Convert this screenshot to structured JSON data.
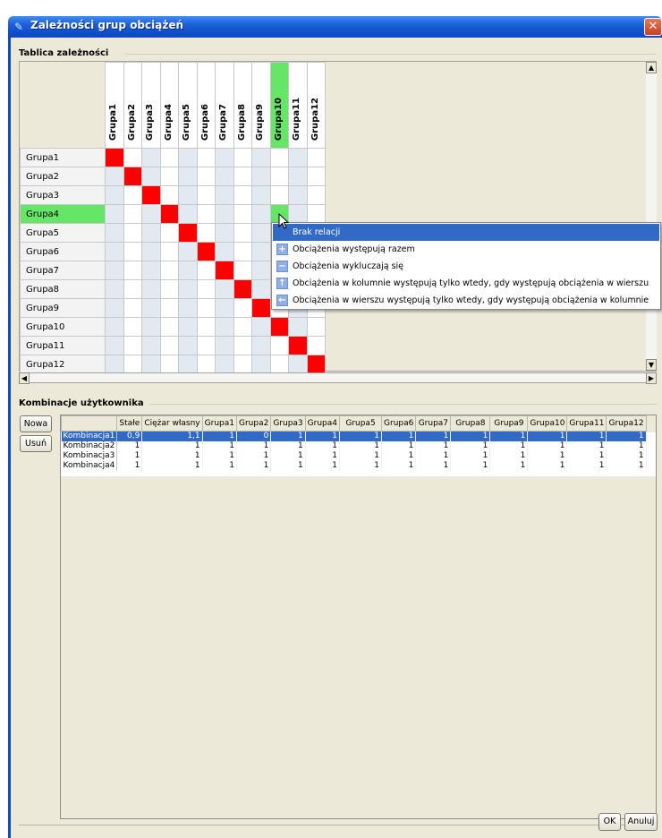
{
  "window": {
    "title": "Zależności grup obciążeń",
    "close_glyph": "✕"
  },
  "matrix_section": {
    "label": "Tablica zależności"
  },
  "matrix": {
    "columns": [
      "Grupa1",
      "Grupa2",
      "Grupa3",
      "Grupa4",
      "Grupa5",
      "Grupa6",
      "Grupa7",
      "Grupa8",
      "Grupa9",
      "Grupa10",
      "Grupa11",
      "Grupa12"
    ],
    "rows": [
      "Grupa1",
      "Grupa2",
      "Grupa3",
      "Grupa4",
      "Grupa5",
      "Grupa6",
      "Grupa7",
      "Grupa8",
      "Grupa9",
      "Grupa10",
      "Grupa11",
      "Grupa12"
    ],
    "highlighted_column": "Grupa10",
    "highlighted_row": "Grupa4",
    "colors": {
      "diagonal": "#ff0000",
      "highlight": "#66e666",
      "stripe": "#e3e9f0"
    }
  },
  "context_menu": {
    "items": [
      {
        "label": "Brak relacji",
        "icon": "none",
        "selected": true
      },
      {
        "label": "Obciążenia występują razem",
        "icon": "plus-icon",
        "selected": false
      },
      {
        "label": "Obciążenia wykluczają się",
        "icon": "minus-icon",
        "selected": false
      },
      {
        "label": "Obciążenia w kolumnie występują tylko wtedy, gdy występują obciążenia w wierszu",
        "icon": "arrow-up-icon",
        "selected": false
      },
      {
        "label": "Obciążenia w wierszu występują tylko wtedy, gdy występują obciążenia w kolumnie",
        "icon": "arrow-left-icon",
        "selected": false
      }
    ]
  },
  "combinations_section": {
    "label": "Kombinacje użytkownika"
  },
  "buttons": {
    "new": "Nowa",
    "delete": "Usuń",
    "ok": "OK",
    "cancel": "Anuluj"
  },
  "combinations": {
    "headers": [
      "",
      "Stałe",
      "Ciężar własny",
      "Grupa1",
      "Grupa2",
      "Grupa3",
      "Grupa4",
      "Grupa5",
      "Grupa6",
      "Grupa7",
      "Grupa8",
      "Grupa9",
      "Grupa10",
      "Grupa11",
      "Grupa12"
    ],
    "rows": [
      {
        "name": "Kombinacja1",
        "values": [
          "0,9",
          "1,1",
          "1",
          "0",
          "1",
          "1",
          "1",
          "1",
          "1",
          "1",
          "1",
          "1",
          "1",
          "1"
        ],
        "selected": true
      },
      {
        "name": "Kombinacja2",
        "values": [
          "1",
          "1",
          "1",
          "1",
          "1",
          "1",
          "1",
          "1",
          "1",
          "1",
          "1",
          "1",
          "1",
          "1"
        ],
        "selected": false
      },
      {
        "name": "Kombinacja3",
        "values": [
          "1",
          "1",
          "1",
          "1",
          "1",
          "1",
          "1",
          "1",
          "1",
          "1",
          "1",
          "1",
          "1",
          "1"
        ],
        "selected": false
      },
      {
        "name": "Kombinacja4",
        "values": [
          "1",
          "1",
          "1",
          "1",
          "1",
          "1",
          "1",
          "1",
          "1",
          "1",
          "1",
          "1",
          "1",
          "1"
        ],
        "selected": false
      }
    ]
  }
}
